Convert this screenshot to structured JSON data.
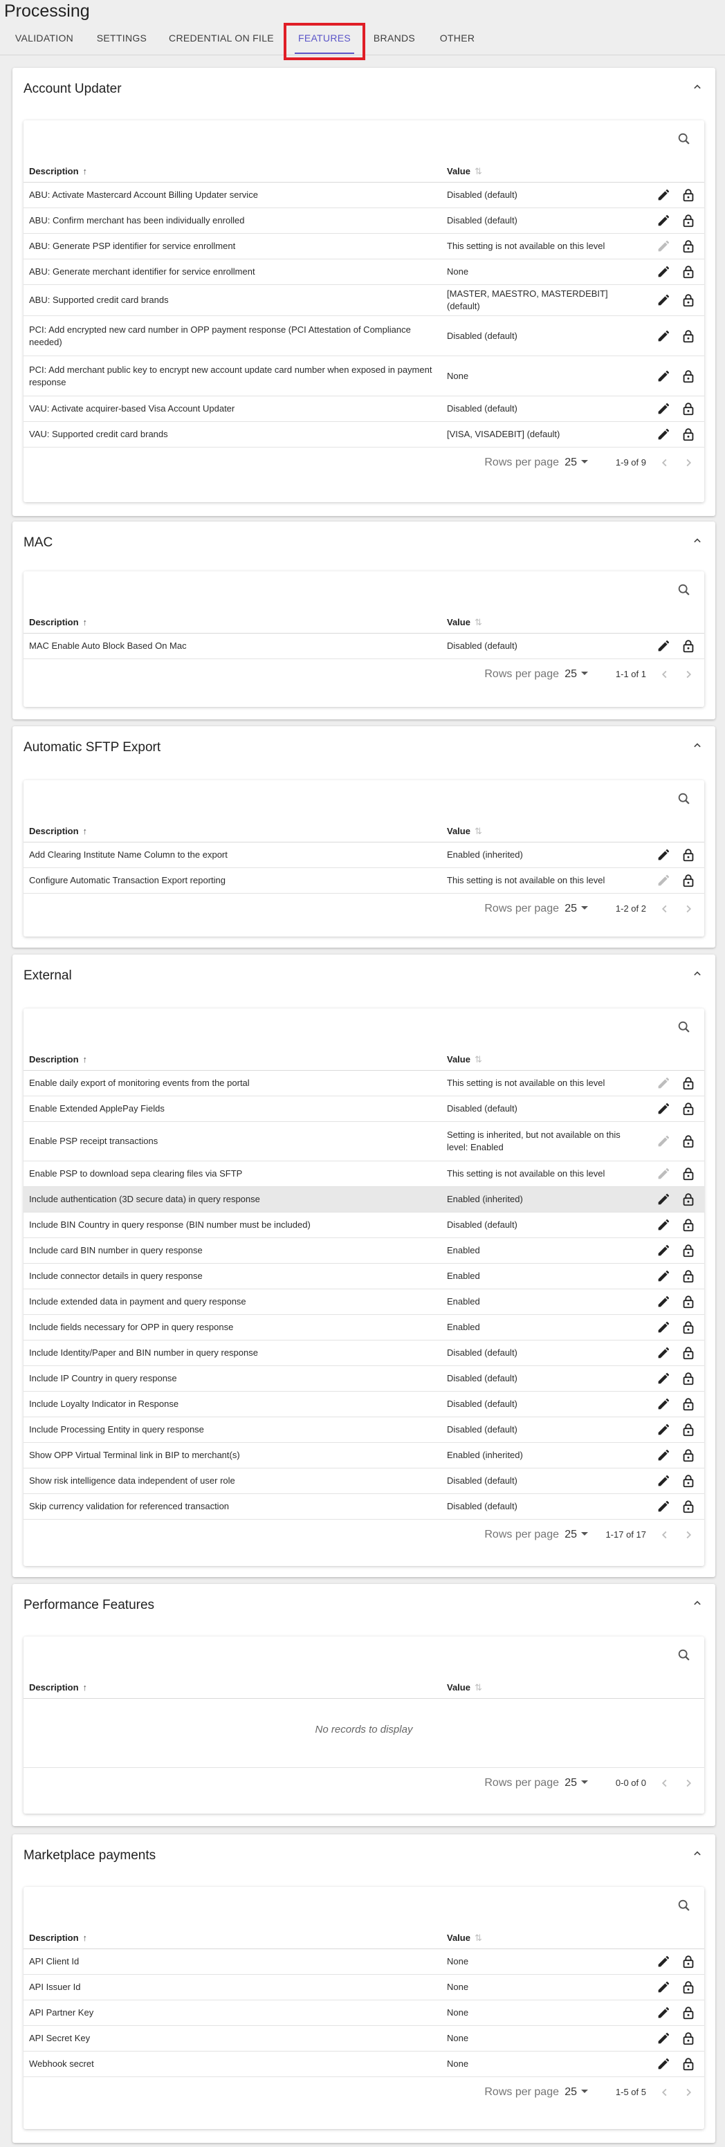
{
  "page_title": "Processing",
  "tabs": [
    {
      "label": "VALIDATION"
    },
    {
      "label": "SETTINGS"
    },
    {
      "label": "CREDENTIAL ON FILE"
    },
    {
      "label": "FEATURES"
    },
    {
      "label": "BRANDS"
    },
    {
      "label": "OTHER"
    }
  ],
  "active_tab": "FEATURES",
  "table_headers": {
    "description": "Description",
    "value": "Value"
  },
  "rows_per_page_label": "Rows per page",
  "rows_per_page_value": "25",
  "colors": {
    "accent": "#5a54c8",
    "highlight_box": "#e01e26"
  },
  "sections": [
    {
      "title": "Account Updater",
      "range": "1-9 of 9",
      "rows": [
        {
          "desc": "ABU: Activate Mastercard Account Billing Updater service",
          "value": "Disabled (default)",
          "edit_enabled": true
        },
        {
          "desc": "ABU: Confirm merchant has been individually enrolled",
          "value": "Disabled (default)",
          "edit_enabled": true
        },
        {
          "desc": "ABU: Generate PSP identifier for service enrollment",
          "value": "This setting is not available on this level",
          "edit_enabled": false
        },
        {
          "desc": "ABU: Generate merchant identifier for service enrollment",
          "value": "None",
          "edit_enabled": true
        },
        {
          "desc": "ABU: Supported credit card brands",
          "value": "[MASTER, MAESTRO, MASTERDEBIT] (default)",
          "edit_enabled": true
        },
        {
          "desc": "PCI: Add encrypted new card number in OPP payment response (PCI Attestation of Compliance needed)",
          "value": "Disabled (default)",
          "edit_enabled": true
        },
        {
          "desc": "PCI: Add merchant public key to encrypt new account update card number when exposed in payment response",
          "value": "None",
          "edit_enabled": true
        },
        {
          "desc": "VAU: Activate acquirer-based Visa Account Updater",
          "value": "Disabled (default)",
          "edit_enabled": true
        },
        {
          "desc": "VAU: Supported credit card brands",
          "value": "[VISA, VISADEBIT] (default)",
          "edit_enabled": true
        }
      ]
    },
    {
      "title": "MAC",
      "range": "1-1 of 1",
      "rows": [
        {
          "desc": "MAC Enable Auto Block Based On Mac",
          "value": "Disabled (default)",
          "edit_enabled": true
        }
      ]
    },
    {
      "title": "Automatic SFTP Export",
      "range": "1-2 of 2",
      "rows": [
        {
          "desc": "Add Clearing Institute Name Column to the export",
          "value": "Enabled (inherited)",
          "edit_enabled": true
        },
        {
          "desc": "Configure Automatic Transaction Export reporting",
          "value": "This setting is not available on this level",
          "edit_enabled": false
        }
      ]
    },
    {
      "title": "External",
      "range": "1-17 of 17",
      "rows": [
        {
          "desc": "Enable daily export of monitoring events from the portal",
          "value": "This setting is not available on this level",
          "edit_enabled": false
        },
        {
          "desc": "Enable Extended ApplePay Fields",
          "value": "Disabled (default)",
          "edit_enabled": true
        },
        {
          "desc": "Enable PSP receipt transactions",
          "value": "Setting is inherited, but not available on this level: Enabled",
          "edit_enabled": false
        },
        {
          "desc": "Enable PSP to download sepa clearing files via SFTP",
          "value": "This setting is not available on this level",
          "edit_enabled": false
        },
        {
          "desc": "Include authentication (3D secure data) in query response",
          "value": "Enabled (inherited)",
          "edit_enabled": true,
          "highlight": true
        },
        {
          "desc": "Include BIN Country in query response (BIN number must be included)",
          "value": "Disabled (default)",
          "edit_enabled": true
        },
        {
          "desc": "Include card BIN number in query response",
          "value": "Enabled",
          "edit_enabled": true
        },
        {
          "desc": "Include connector details in query response",
          "value": "Enabled",
          "edit_enabled": true
        },
        {
          "desc": "Include extended data in payment and query response",
          "value": "Enabled",
          "edit_enabled": true
        },
        {
          "desc": "Include fields necessary for OPP in query response",
          "value": "Enabled",
          "edit_enabled": true
        },
        {
          "desc": "Include Identity/Paper and BIN number in query response",
          "value": "Disabled (default)",
          "edit_enabled": true
        },
        {
          "desc": "Include IP Country in query response",
          "value": "Disabled (default)",
          "edit_enabled": true
        },
        {
          "desc": "Include Loyalty Indicator in Response",
          "value": "Disabled (default)",
          "edit_enabled": true
        },
        {
          "desc": "Include Processing Entity in query response",
          "value": "Disabled (default)",
          "edit_enabled": true
        },
        {
          "desc": "Show OPP Virtual Terminal link in BIP to merchant(s)",
          "value": "Enabled (inherited)",
          "edit_enabled": true
        },
        {
          "desc": "Show risk intelligence data independent of user role",
          "value": "Disabled (default)",
          "edit_enabled": true
        },
        {
          "desc": "Skip currency validation for referenced transaction",
          "value": "Disabled (default)",
          "edit_enabled": true
        }
      ]
    },
    {
      "title": "Performance Features",
      "range": "0-0 of 0",
      "empty_text": "No records to display",
      "rows": []
    },
    {
      "title": "Marketplace payments",
      "range": "1-5 of 5",
      "rows": [
        {
          "desc": "API Client Id",
          "value": "None",
          "edit_enabled": true
        },
        {
          "desc": "API Issuer Id",
          "value": "None",
          "edit_enabled": true
        },
        {
          "desc": "API Partner Key",
          "value": "None",
          "edit_enabled": true
        },
        {
          "desc": "API Secret Key",
          "value": "None",
          "edit_enabled": true
        },
        {
          "desc": "Webhook secret",
          "value": "None",
          "edit_enabled": true
        }
      ]
    }
  ]
}
